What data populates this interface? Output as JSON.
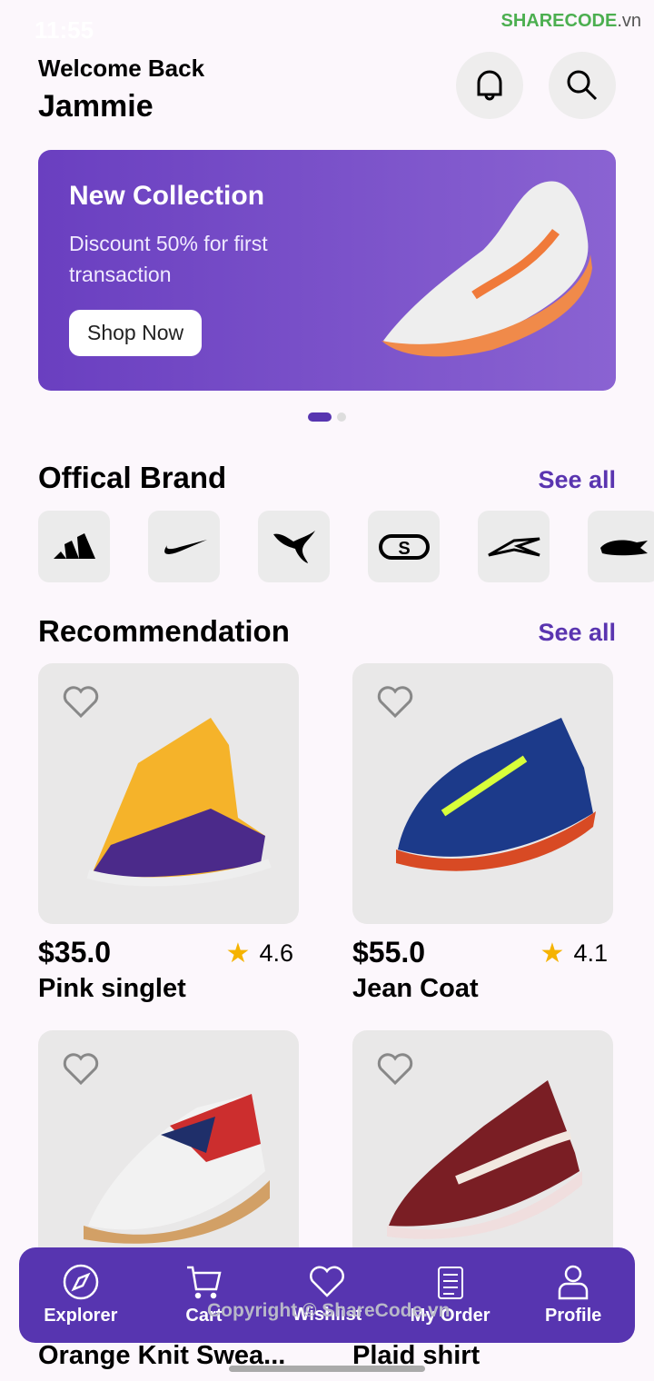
{
  "status": {
    "time": "11:55"
  },
  "watermark": {
    "brand": "SHARECODE",
    ".vn": ".vn",
    "tld": ".vn",
    "copyright": "Copyright © ShareCode.vn",
    "center": "ShareCode.vn"
  },
  "header": {
    "greeting": "Welcome Back",
    "user": "Jammie"
  },
  "banner": {
    "title": "New Collection",
    "subtitle": "Discount 50% for first transaction",
    "button": "Shop Now",
    "slides": 2,
    "active_slide": 1
  },
  "brands": {
    "title": "Offical Brand",
    "see_all": "See all",
    "items": [
      "adidas",
      "nike",
      "puma",
      "skechers",
      "reebok",
      "lacoste"
    ]
  },
  "recommendation": {
    "title": "Recommendation",
    "see_all": "See all",
    "products": [
      {
        "price": "$35.0",
        "rating": "4.6",
        "name": "Pink singlet"
      },
      {
        "price": "$55.0",
        "rating": "4.1",
        "name": "Jean Coat"
      },
      {
        "price": "",
        "rating": "",
        "name": "Orange Knit Swea..."
      },
      {
        "price": "",
        "rating": "",
        "name": "Plaid shirt"
      }
    ]
  },
  "nav": [
    {
      "label": "Explorer",
      "icon": "compass-icon"
    },
    {
      "label": "Cart",
      "icon": "cart-icon"
    },
    {
      "label": "Wishlist",
      "icon": "heart-icon"
    },
    {
      "label": "My Order",
      "icon": "clipboard-icon"
    },
    {
      "label": "Profile",
      "icon": "user-icon"
    }
  ],
  "colors": {
    "accent": "#5735b0",
    "banner": "#7a52cc",
    "star": "#f5b301"
  }
}
